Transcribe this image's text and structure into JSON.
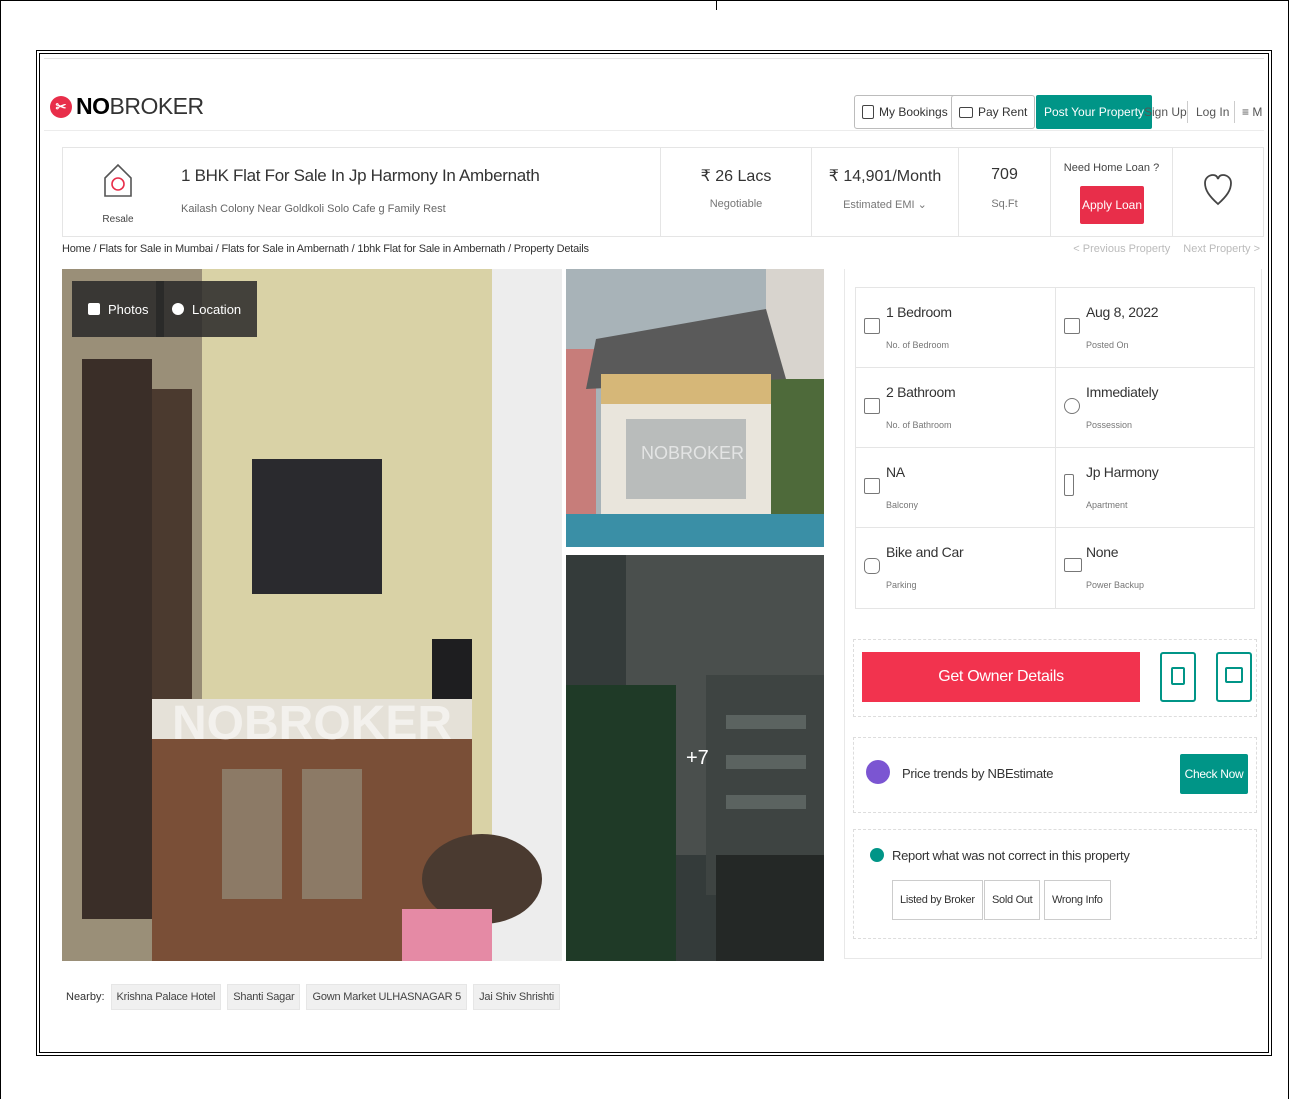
{
  "header": {
    "logo": {
      "bold": "NO",
      "rest": "BROKER"
    },
    "my_bookings": "My Bookings",
    "pay_rent": "Pay Rent",
    "post_property": "Post Your Property",
    "sign_up": "Sign Up",
    "log_in": "Log In",
    "menu": "≡ M"
  },
  "property": {
    "type_label": "Resale",
    "title": "1 BHK Flat For Sale In Jp Harmony In Ambernath",
    "address": "Kailash Colony Near Goldkoli Solo Cafe g Family Rest",
    "price": "₹ 26 Lacs",
    "price_note": "Negotiable",
    "emi": "₹ 14,901/Month",
    "emi_note": "Estimated EMI ⌄",
    "area": "709",
    "area_unit": "Sq.Ft",
    "loan_question": "Need Home Loan ?",
    "loan_button": "Apply Loan"
  },
  "breadcrumb": {
    "path": "Home / Flats for Sale in Mumbai / Flats for Sale in Ambernath / 1bhk Flat for Sale in Ambernath / Property Details",
    "prev": "< Previous Property",
    "next": "Next Property >"
  },
  "gallery": {
    "photos_btn": "Photos",
    "location_btn": "Location",
    "more_count": "+7"
  },
  "nearby": {
    "label": "Nearby:",
    "items": [
      "Krishna Palace Hotel",
      "Shanti Sagar",
      "Gown Market ULHASNAGAR 5",
      "Jai Shiv Shrishti"
    ]
  },
  "specs": [
    {
      "value": "1 Bedroom",
      "label": "No. of Bedroom",
      "icon": "bed-icon"
    },
    {
      "value": "Aug 8, 2022",
      "label": "Posted On",
      "icon": "calendar-icon"
    },
    {
      "value": "2 Bathroom",
      "label": "No. of Bathroom",
      "icon": "bathtub-icon"
    },
    {
      "value": "Immediately",
      "label": "Possession",
      "icon": "key-icon"
    },
    {
      "value": "NA",
      "label": "Balcony",
      "icon": "balcony-icon"
    },
    {
      "value": "Jp Harmony",
      "label": "Apartment",
      "icon": "building-icon"
    },
    {
      "value": "Bike and Car",
      "label": "Parking",
      "icon": "car-icon"
    },
    {
      "value": "None",
      "label": "Power Backup",
      "icon": "battery-icon"
    }
  ],
  "actions": {
    "owner_details": "Get Owner Details",
    "trend_text": "Price trends by NBEstimate",
    "check_now": "Check Now",
    "report_text": "Report what was not correct in this property",
    "report_options": [
      "Listed by Broker",
      "Sold Out",
      "Wrong Info"
    ]
  },
  "colors": {
    "brand_red": "#e82e4a",
    "brand_teal": "#009587",
    "trend_purple": "#7b55d2"
  }
}
